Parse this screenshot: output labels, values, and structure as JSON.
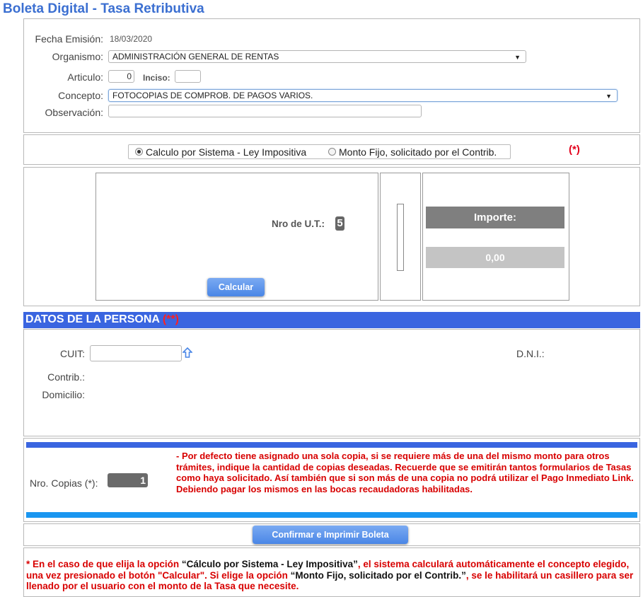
{
  "page_title": "Boleta Digital - Tasa Retributiva",
  "form": {
    "fecha_label": "Fecha Emisión:",
    "fecha_value": "18/03/2020",
    "organismo_label": "Organismo:",
    "organismo_value": "ADMINISTRACIÓN GENERAL DE RENTAS",
    "articulo_label": "Articulo:",
    "articulo_value": "0",
    "inciso_label": "Inciso:",
    "inciso_value": "",
    "concepto_label": "Concepto:",
    "concepto_value": "FOTOCOPIAS DE COMPROB. DE PAGOS VARIOS.",
    "observacion_label": "Observación:",
    "observacion_value": ""
  },
  "calc_mode": {
    "option1_label": "Calculo por Sistema - Ley Impositiva",
    "option2_label": "Monto Fijo, solicitado por el Contrib.",
    "selected": "option1",
    "required_mark": "(*)"
  },
  "calc": {
    "ut_label": "Nro de U.T.:",
    "ut_value": "5",
    "calcular_label": "Calcular",
    "importe_label": "Importe:",
    "importe_value": "0,00"
  },
  "persona": {
    "section_title": "DATOS DE LA PERSONA",
    "section_mark": "(**)",
    "cuit_label": "CUIT:",
    "cuit_value": "",
    "dni_label": "D.N.I.:",
    "contrib_label": "Contrib.:",
    "domicilio_label": "Domicilio:"
  },
  "copias": {
    "label": "Nro. Copias (*):",
    "value": "1",
    "note": "- Por defecto tiene asignado una sola copia, si se requiere más de una del mismo monto para otros trámites, indique la cantidad de copias deseadas. Recuerde que se emitirán tantos formularios de Tasas como haya solicitado. Así también que si son más de una copia no podrá utilizar el Pago Inmediato Link. Debiendo pagar los mismos en las bocas recaudadoras habilitadas."
  },
  "confirm_label": "Confirmar e Imprimir Boleta",
  "footnote": {
    "p1": "* En el caso de que elija la opción ",
    "q1": "“Cálculo por Sistema - Ley Impositiva”",
    "p2": ", el sistema calculará automáticamente el concepto elegido, una vez presionado el botón \"Calcular\". Si elige la opción ",
    "q2": "“Monto Fijo, solicitado por el Contrib.”",
    "p3": ", se le habilitará un casillero para ser llenado por el usuario con el monto de la Tasa que necesite."
  },
  "colors": {
    "title_blue": "#3b6fd1",
    "section_blue": "#3a65e0",
    "required_red": "#e3001b",
    "importe_header": "#7f7f7f",
    "importe_value_bg": "#c4c4c4"
  }
}
